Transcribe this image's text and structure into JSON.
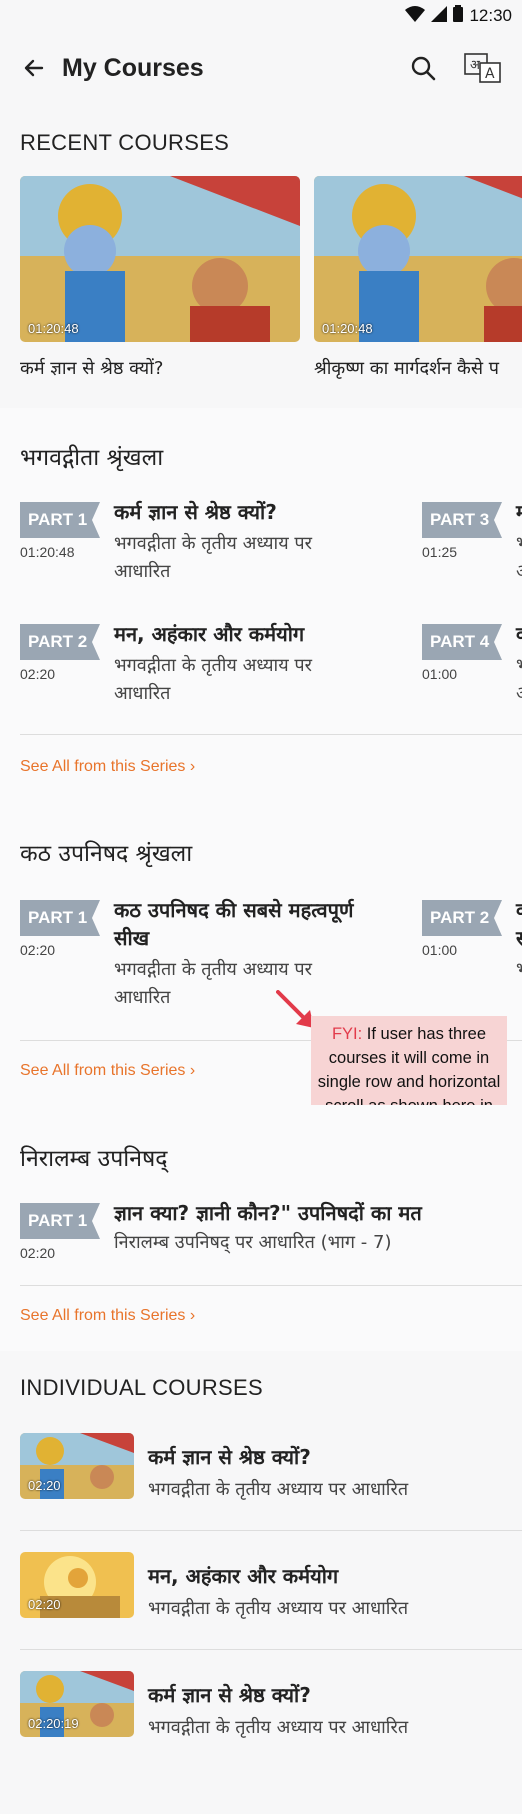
{
  "status": {
    "time": "12:30"
  },
  "appbar": {
    "title": "My Courses"
  },
  "recent": {
    "heading": "RECENT COURSES",
    "items": [
      {
        "duration": "01:20:48",
        "title": "कर्म ज्ञान से श्रेष्ठ क्यों?"
      },
      {
        "duration": "01:20:48",
        "title": "श्रीकृष्ण का मार्गदर्शन कैसे प"
      }
    ]
  },
  "series1": {
    "heading": "भगवद्गीता श्रृंखला",
    "items": [
      {
        "part": "PART 1",
        "duration": "01:20:48",
        "title": "कर्म ज्ञान से श्रेष्ठ क्यों?",
        "subtitle_l1": "भगवद्गीता के तृतीय अध्याय पर",
        "subtitle_l2": "आधारित"
      },
      {
        "part": "PART 3",
        "duration": "01:25",
        "title": "म",
        "subtitle_l1": "भ",
        "subtitle_l2": "आ"
      },
      {
        "part": "PART 2",
        "duration": "02:20",
        "title": "मन, अहंकार और कर्मयोग",
        "subtitle_l1": "भगवद्गीता के तृतीय अध्याय पर",
        "subtitle_l2": "आधारित"
      },
      {
        "part": "PART 4",
        "duration": "01:00",
        "title": "व",
        "subtitle_l1": "भ",
        "subtitle_l2": "आ"
      }
    ],
    "see_all": "See All from this Series"
  },
  "series2": {
    "heading": "कठ उपनिषद श्रृंखला",
    "items": [
      {
        "part": "PART 1",
        "duration": "02:20",
        "title_l1": "कठ उपनिषद की सबसे महत्वपूर्ण",
        "title_l2": "सीख",
        "subtitle_l1": "भगवद्गीता के तृतीय अध्याय पर",
        "subtitle_l2": "आधारित"
      },
      {
        "part": "PART 2",
        "duration": "01:00",
        "title_l1": "क",
        "title_l2": "स",
        "subtitle_l1": "भ"
      }
    ],
    "see_all": "See All from this Series"
  },
  "fyi": {
    "label": "FYI:",
    "text": " If user has three courses it will come in single row and horizontal scroll as shown here in second series"
  },
  "series3": {
    "heading": "निरालम्ब उपनिषद्",
    "items": [
      {
        "part": "PART 1",
        "duration": "02:20",
        "title": "ज्ञान क्या? ज्ञानी कौन?\" उपनिषदों का मत",
        "subtitle": "निरालम्ब उपनिषद् पर आधारित (भाग - 7)"
      }
    ],
    "see_all": "See All from this Series"
  },
  "individual": {
    "heading": "INDIVIDUAL COURSES",
    "items": [
      {
        "duration": "02:20",
        "title": "कर्म ज्ञान से श्रेष्ठ क्यों?",
        "subtitle": "भगवद्गीता के तृतीय अध्याय पर आधारित"
      },
      {
        "duration": "02:20",
        "title": "मन, अहंकार और कर्मयोग",
        "subtitle": "भगवद्गीता के तृतीय अध्याय पर आधारित"
      },
      {
        "duration": "02:20:19",
        "title": "कर्म ज्ञान से श्रेष्ठ क्यों?",
        "subtitle": "भगवद्गीता के तृतीय अध्याय पर आधारित"
      }
    ]
  },
  "colors": {
    "accent": "#e8742b",
    "part_badge": "#9aa6b3",
    "fyi_bg": "#f7d4d4",
    "fyi_label": "#e23a4a"
  }
}
